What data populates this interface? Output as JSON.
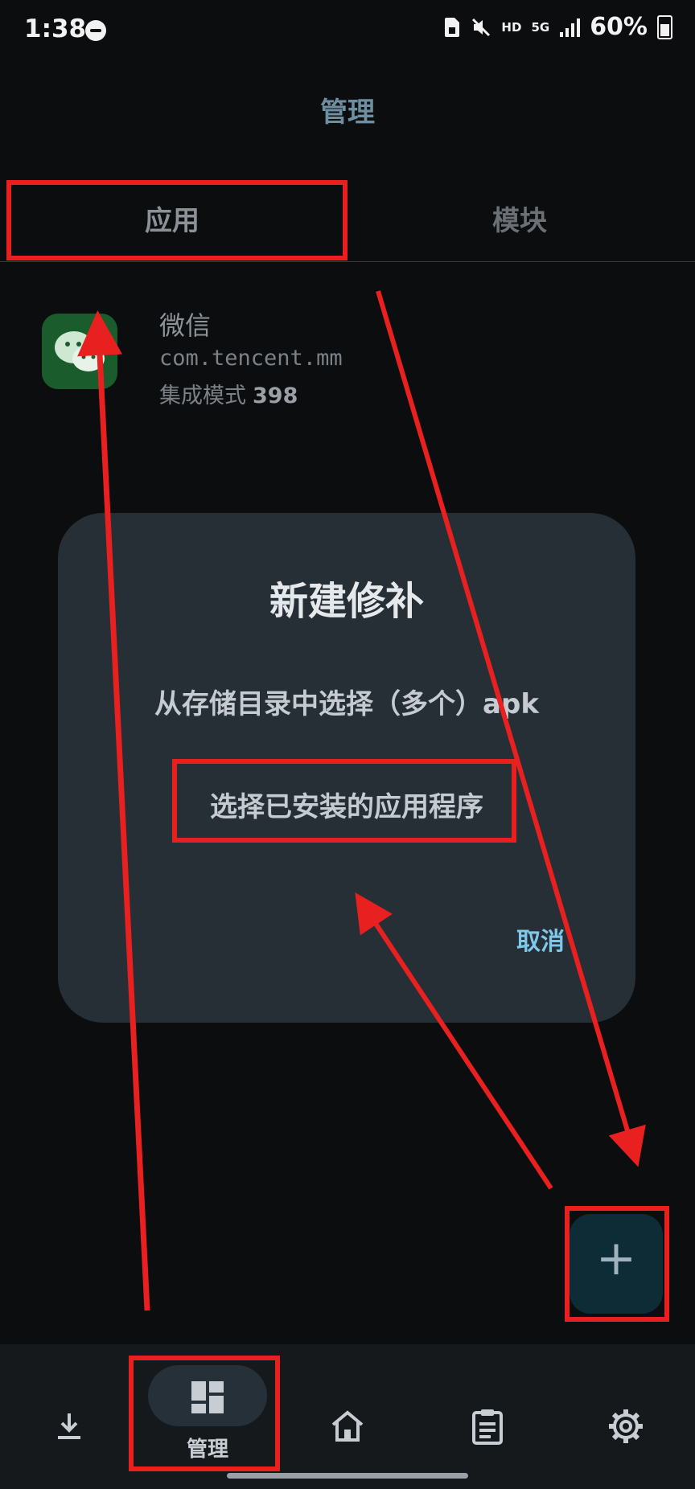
{
  "status_bar": {
    "time": "1:38",
    "network_hd": "HD",
    "network_5g": "5G",
    "battery": "60%"
  },
  "header": {
    "title": "管理"
  },
  "tabs": [
    {
      "label": "应用"
    },
    {
      "label": "模块"
    }
  ],
  "app_list": [
    {
      "name": "微信",
      "package": "com.tencent.mm",
      "mode": "集成模式",
      "version": "398",
      "icon": "wechat-icon"
    }
  ],
  "dialog": {
    "title": "新建修补",
    "option_storage": "从存储目录中选择（多个）apk",
    "option_installed": "选择已安装的应用程序",
    "cancel": "取消"
  },
  "fab": {
    "icon": "plus-icon",
    "label": "+"
  },
  "bottom_nav": {
    "items": [
      {
        "icon": "download-icon",
        "label": ""
      },
      {
        "icon": "dashboard-icon",
        "label": "管理"
      },
      {
        "icon": "home-icon",
        "label": ""
      },
      {
        "icon": "clipboard-icon",
        "label": ""
      },
      {
        "icon": "gear-icon",
        "label": ""
      }
    ],
    "active_index": 1
  },
  "colors": {
    "annotation_red": "#e8201f",
    "accent_blue": "#7fc8ea",
    "dialog_bg": "#262f36"
  }
}
